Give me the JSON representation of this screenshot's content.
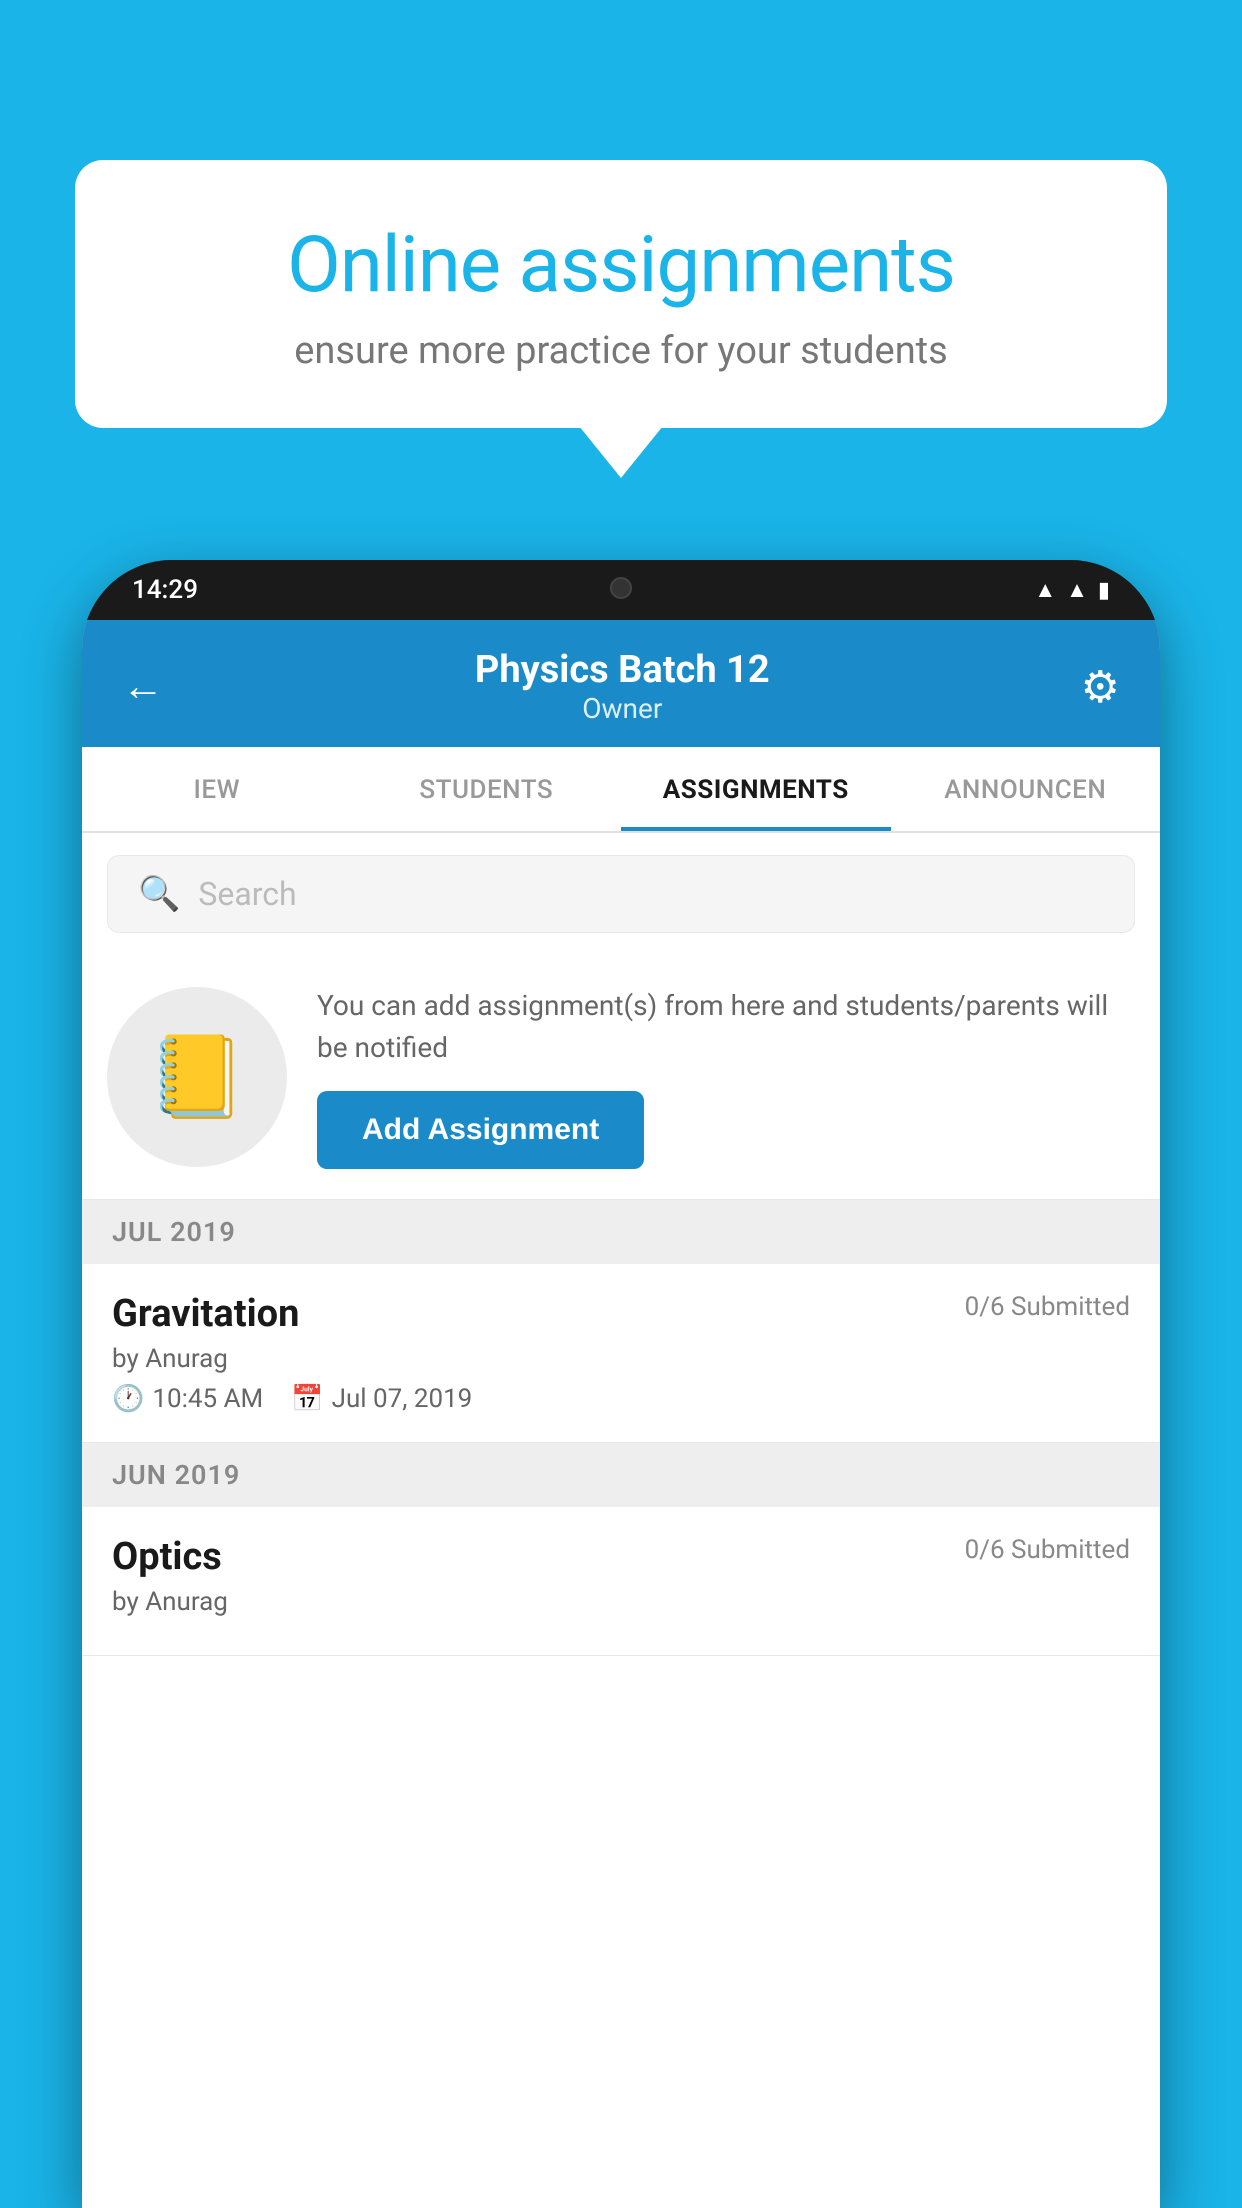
{
  "background_color": "#1ab4e8",
  "speech_bubble": {
    "title": "Online assignments",
    "subtitle": "ensure more practice for your students"
  },
  "phone": {
    "status_time": "14:29",
    "header": {
      "title": "Physics Batch 12",
      "subtitle": "Owner",
      "back_label": "←",
      "settings_label": "⚙"
    },
    "tabs": [
      {
        "label": "IEW",
        "active": false
      },
      {
        "label": "STUDENTS",
        "active": false
      },
      {
        "label": "ASSIGNMENTS",
        "active": true
      },
      {
        "label": "ANNOUNCEN",
        "active": false
      }
    ],
    "search": {
      "placeholder": "Search"
    },
    "promo": {
      "text": "You can add assignment(s) from here and students/parents will be notified",
      "button_label": "Add Assignment"
    },
    "sections": [
      {
        "header": "JUL 2019",
        "assignments": [
          {
            "name": "Gravitation",
            "submitted": "0/6 Submitted",
            "by": "by Anurag",
            "time": "10:45 AM",
            "date": "Jul 07, 2019"
          }
        ]
      },
      {
        "header": "JUN 2019",
        "assignments": [
          {
            "name": "Optics",
            "submitted": "0/6 Submitted",
            "by": "by Anurag",
            "time": "",
            "date": ""
          }
        ]
      }
    ]
  }
}
